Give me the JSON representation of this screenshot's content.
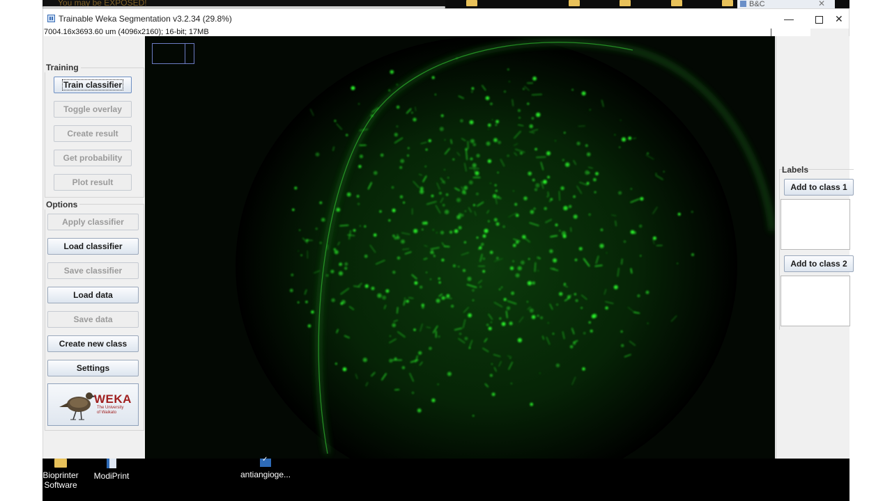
{
  "window": {
    "title": "Trainable Weka Segmentation v3.2.34 (29.8%)",
    "image_info": "7004.16x3693.60 um (4096x2160); 16-bit; 17MB",
    "minimize_glyph": "—",
    "close_glyph": "✕"
  },
  "background_window": {
    "tab_title": "B&C",
    "ghost_text": "You may be EXPOSED!"
  },
  "training": {
    "group_label": "Training",
    "buttons": [
      {
        "label": "Train classifier",
        "enabled": true
      },
      {
        "label": "Toggle overlay",
        "enabled": false
      },
      {
        "label": "Create result",
        "enabled": false
      },
      {
        "label": "Get probability",
        "enabled": false
      },
      {
        "label": "Plot result",
        "enabled": false
      }
    ]
  },
  "options": {
    "group_label": "Options",
    "buttons": [
      {
        "label": "Apply classifier",
        "enabled": false
      },
      {
        "label": "Load classifier",
        "enabled": true
      },
      {
        "label": "Save classifier",
        "enabled": false
      },
      {
        "label": "Load data",
        "enabled": true
      },
      {
        "label": "Save data",
        "enabled": false
      },
      {
        "label": "Create new class",
        "enabled": true
      },
      {
        "label": "Settings",
        "enabled": true
      }
    ]
  },
  "logo": {
    "word": "WEKA",
    "subtitle": "The University of Waikato"
  },
  "labels": {
    "title": "Labels",
    "classes": [
      {
        "button": "Add to class 1"
      },
      {
        "button": "Add to class 2"
      }
    ]
  },
  "taskbar": {
    "icons": [
      {
        "label": "Bioprinter Software",
        "icon": "folder-icon"
      },
      {
        "label": "ModiPrint",
        "icon": "app-icon"
      },
      {
        "label": "antiangioge...",
        "icon": "document-icon"
      }
    ]
  },
  "colors": {
    "fluorescence": "#2cff2c",
    "canvas_background": "#000000"
  }
}
